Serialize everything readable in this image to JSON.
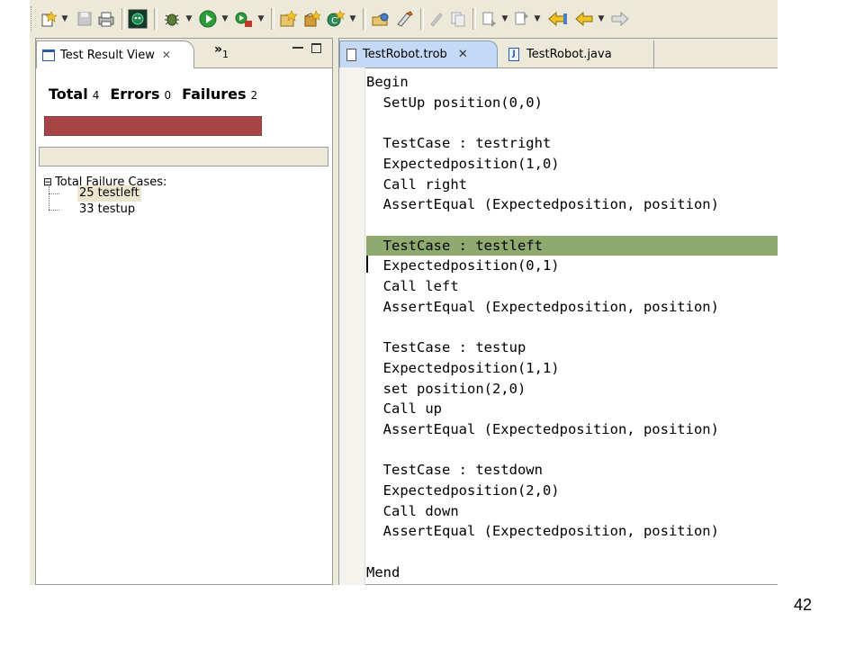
{
  "toolbar": {
    "icons": [
      "new-wizard-icon",
      "save-icon",
      "print-icon",
      "robot-icon",
      "debug-icon",
      "run-icon",
      "external-tools-icon",
      "new-java-project-icon",
      "new-package-icon",
      "new-class-icon",
      "open-type-icon",
      "search-icon",
      "toggle-mark-icon",
      "compare-icon",
      "next-annotation-icon",
      "previous-annotation-icon",
      "last-edit-icon",
      "back-icon",
      "forward-icon"
    ]
  },
  "left_view": {
    "tab_label": "Test Result View",
    "overflow_label": "»",
    "overflow_count": "1",
    "summary": {
      "total_label": "Total",
      "total_value": "4",
      "errors_label": "Errors",
      "errors_value": "0",
      "failures_label": "Failures",
      "failures_value": "2"
    },
    "progress_status": "failure",
    "progress_color": "#a64646",
    "tree": {
      "root": "Total Failure Cases:",
      "expander": "⊟",
      "children": [
        "25 testleft",
        "33 testup"
      ]
    }
  },
  "editor": {
    "tabs": [
      {
        "label": "TestRobot.trob",
        "active": true
      },
      {
        "label": "TestRobot.java",
        "active": false
      }
    ],
    "highlight_color": "#8faa6e",
    "lines": [
      "Begin",
      "  SetUp position(0,0)",
      "",
      "  TestCase : testright",
      "  Expectedposition(1,0)",
      "  Call right",
      "  AssertEqual (Expectedposition, position)",
      "",
      "  TestCase : testleft",
      "  Expectedposition(0,1)",
      "  Call left",
      "  AssertEqual (Expectedposition, position)",
      "",
      "  TestCase : testup",
      "  Expectedposition(1,1)",
      "  set position(2,0)",
      "  Call up",
      "  AssertEqual (Expectedposition, position)",
      "",
      "  TestCase : testdown",
      "  Expectedposition(2,0)",
      "  Call down",
      "  AssertEqual (Expectedposition, position)",
      "",
      "Mend"
    ],
    "highlighted_line": 8
  },
  "page_number": "42"
}
